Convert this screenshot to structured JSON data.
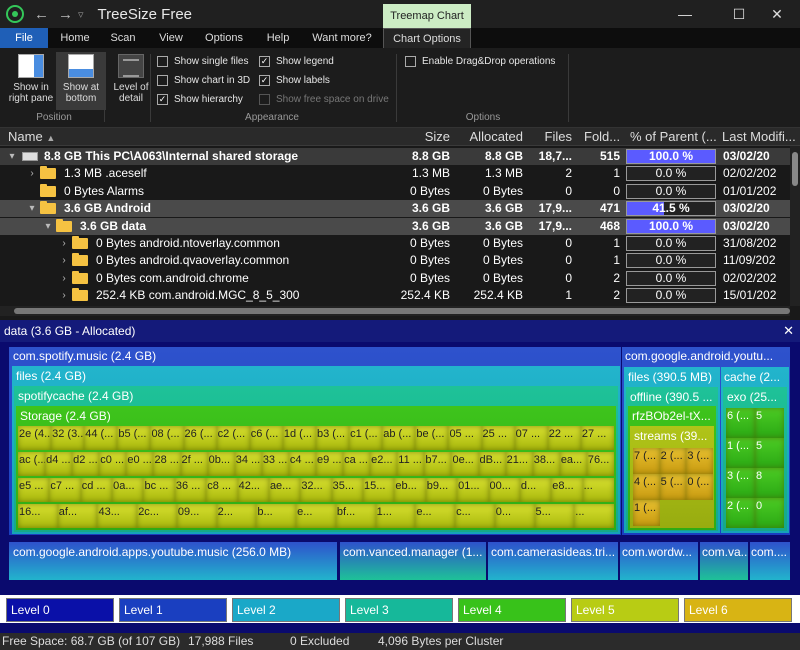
{
  "window": {
    "title": "TreeSize Free",
    "context_tab": "Treemap Chart",
    "minimize": "—",
    "maximize": "☐",
    "close": "✕"
  },
  "tabs": [
    "File",
    "Home",
    "Scan",
    "View",
    "Options",
    "Help",
    "Want more?",
    "Chart Options"
  ],
  "ribbon": {
    "position": {
      "label": "Position",
      "show_right": "Show in right pane",
      "show_bottom": "Show at bottom"
    },
    "level_of_detail": "Level of detail",
    "appearance": {
      "label": "Appearance",
      "show_single_files": "Show single files",
      "show_chart_3d": "Show chart in 3D",
      "show_hierarchy": "Show hierarchy",
      "show_legend": "Show legend",
      "show_labels": "Show labels",
      "show_free_space": "Show free space on drive"
    },
    "options": {
      "label": "Options",
      "drag_drop": "Enable Drag&Drop operations"
    }
  },
  "table": {
    "headers": [
      "Name",
      "Size",
      "Allocated",
      "Files",
      "Fold...",
      "% of Parent (...",
      "Last Modifi..."
    ],
    "rows": [
      {
        "name": "8.8 GB   This PC\\A063\\Internal shared storage",
        "size": "8.8 GB",
        "alloc": "8.8 GB",
        "files": "18,7...",
        "folders": "515",
        "pct": "100.0 %",
        "pct_value": 100,
        "modified": "03/02/20"
      },
      {
        "name": "1.3 MB   .aceself",
        "size": "1.3 MB",
        "alloc": "1.3 MB",
        "files": "2",
        "folders": "1",
        "pct": "0.0 %",
        "pct_value": 0,
        "modified": "02/02/202"
      },
      {
        "name": "0 Bytes   Alarms",
        "size": "0 Bytes",
        "alloc": "0 Bytes",
        "files": "0",
        "folders": "0",
        "pct": "0.0 %",
        "pct_value": 0,
        "modified": "01/01/202"
      },
      {
        "name": "3.6 GB   Android",
        "size": "3.6 GB",
        "alloc": "3.6 GB",
        "files": "17,9...",
        "folders": "471",
        "pct": "41.5 %",
        "pct_value": 41.5,
        "modified": "03/02/20"
      },
      {
        "name": "3.6 GB   data",
        "size": "3.6 GB",
        "alloc": "3.6 GB",
        "files": "17,9...",
        "folders": "468",
        "pct": "100.0 %",
        "pct_value": 100,
        "modified": "03/02/20"
      },
      {
        "name": "0 Bytes   android.ntoverlay.common",
        "size": "0 Bytes",
        "alloc": "0 Bytes",
        "files": "0",
        "folders": "1",
        "pct": "0.0 %",
        "pct_value": 0,
        "modified": "31/08/202"
      },
      {
        "name": "0 Bytes   android.qvaoverlay.common",
        "size": "0 Bytes",
        "alloc": "0 Bytes",
        "files": "0",
        "folders": "1",
        "pct": "0.0 %",
        "pct_value": 0,
        "modified": "11/09/202"
      },
      {
        "name": "0 Bytes   com.android.chrome",
        "size": "0 Bytes",
        "alloc": "0 Bytes",
        "files": "0",
        "folders": "2",
        "pct": "0.0 %",
        "pct_value": 0,
        "modified": "02/02/202"
      },
      {
        "name": "252.4 KB   com.android.MGC_8_5_300",
        "size": "252.4 KB",
        "alloc": "252.4 KB",
        "files": "1",
        "folders": "2",
        "pct": "0.0 %",
        "pct_value": 0,
        "modified": "15/01/202"
      }
    ]
  },
  "treemap": {
    "header": "data (3.6 GB - Allocated)",
    "spotify": "com.spotify.music (2.4 GB)",
    "files": "files (2.4 GB)",
    "spotifycache": "spotifycache (2.4 GB)",
    "storage": "Storage (2.4 GB)",
    "youtube": "com.google.android.youtu...",
    "yt_files": "files (390.5 MB)",
    "yt_offline": "offline (390.5 ...",
    "yt_id": "rfzBOb2el-tX...",
    "yt_streams": "streams (39...",
    "yt_cache": "cache (2...",
    "yt_exo": "exo (25...",
    "yt_music": "com.google.android.apps.youtube.music (256.0 MB)",
    "vanced": "com.vanced.manager (1...",
    "camera": "com.camerasideas.tri...",
    "wordw": "com.wordw...",
    "va": "com.va...",
    "com": "com....",
    "cell_rows": [
      [
        "2e (4...",
        "32 (3...",
        "44 (...",
        "b5 (...",
        "08 (...",
        "26 (...",
        "c2 (...",
        "c6 (...",
        "1d (...",
        "b3 (...",
        "c1 (...",
        "ab (...",
        "be (...",
        "05 ...",
        "25 ...",
        "07 ...",
        "22 ...",
        "27 ..."
      ],
      [
        "ac (...",
        "d4 ...",
        "d2 ...",
        "c0 ...",
        "e0 ...",
        "28 ...",
        "2f ...",
        "0b...",
        "34 ...",
        "33 ...",
        "c4 ...",
        "e9 ...",
        "ca ...",
        "e2...",
        "11 ...",
        "b7...",
        "0e...",
        "dB...",
        "21...",
        "38...",
        "ea...",
        "76..."
      ],
      [
        "e5 ...",
        "c7 ...",
        "cd ...",
        "0a...",
        "bc ...",
        "36 ...",
        "c8 ...",
        "42...",
        "ae...",
        "32...",
        "35...",
        "15...",
        "eb...",
        "b9...",
        "01...",
        "00...",
        "d...",
        "e8...",
        "..."
      ],
      [
        "16...",
        "af...",
        "43...",
        "2c...",
        "09...",
        "2...",
        "b...",
        "e...",
        "bf...",
        "1...",
        "e...",
        "c...",
        "0...",
        "5...",
        "..."
      ]
    ],
    "stream_cells": [
      "7 (...",
      "2 (...",
      "3 (...",
      "4 (...",
      "5 (...",
      "0 (...",
      "1 (..."
    ],
    "exo_cells": [
      "6 (...",
      "5",
      "1 (...",
      "5",
      "3 (...",
      "8",
      "2 (...",
      "0"
    ],
    "legend": [
      "Level 0",
      "Level 1",
      "Level 2",
      "Level 3",
      "Level 4",
      "Level 5",
      "Level 6"
    ],
    "legend_colors": [
      "#0a10a8",
      "#1a3fc0",
      "#1aa8c8",
      "#16b89a",
      "#38c21a",
      "#b8cc14",
      "#d8b414"
    ]
  },
  "status": {
    "free": "Free Space: 68.7 GB  (of 107 GB)",
    "files": "17,988 Files",
    "excluded": "0 Excluded",
    "cluster": "4,096 Bytes per Cluster"
  }
}
